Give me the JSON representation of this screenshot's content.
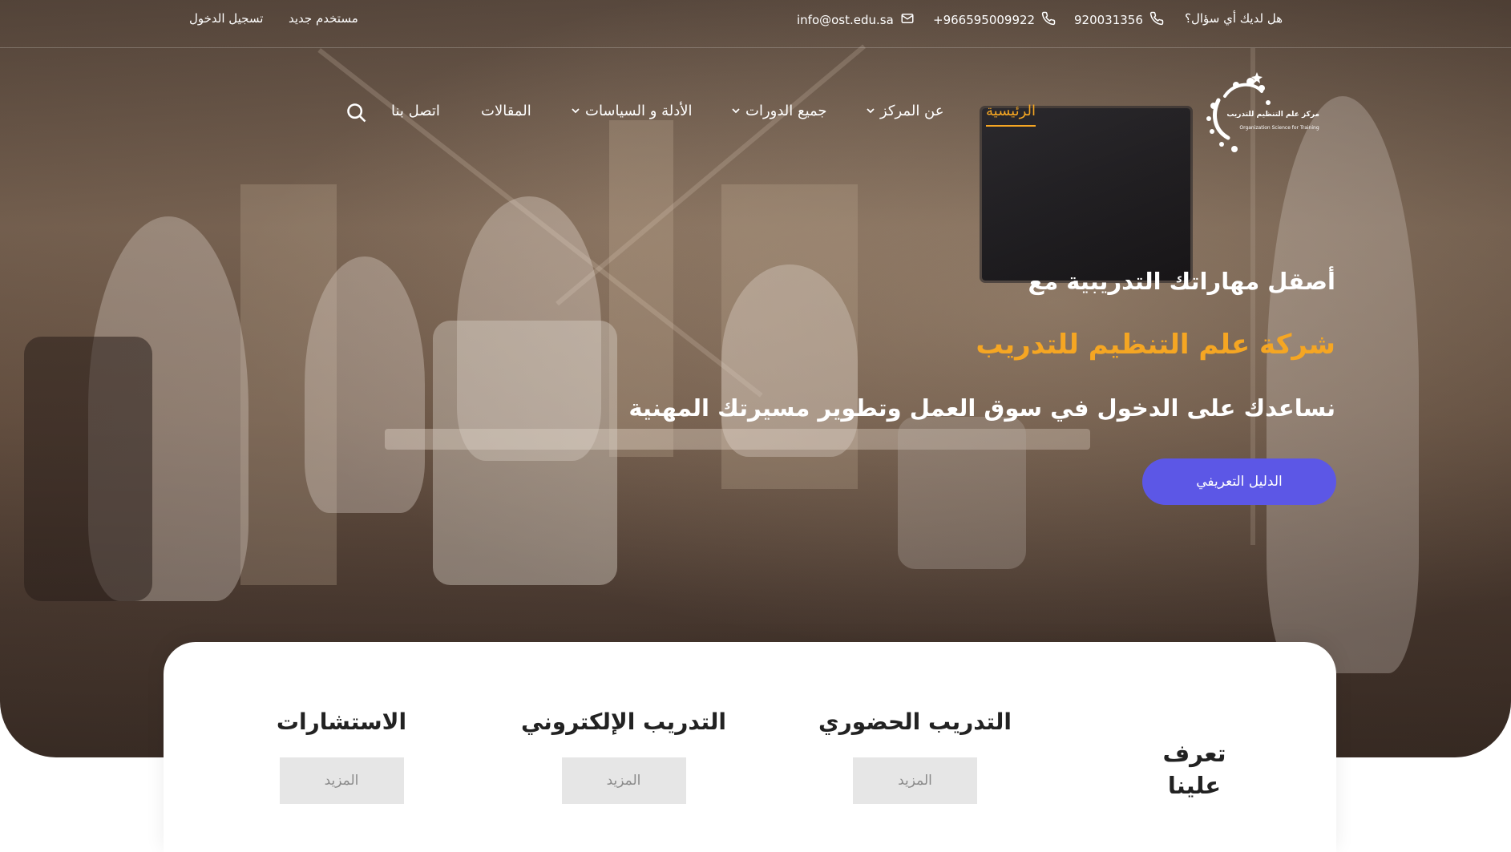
{
  "topbar": {
    "question": "هل لديك أي سؤال؟",
    "phone1": "920031356",
    "phone2": "+966595009922",
    "email": "info@ost.edu.sa",
    "register": "مستخدم جديد",
    "login": "تسجيل الدخول"
  },
  "logo": {
    "name_ar": "مركز علم التنظيم للتدريب",
    "name_en": "Organization Science for Training"
  },
  "nav": {
    "home": "الرئيسية",
    "about": "عن المركز",
    "courses": "جميع الدورات",
    "policies": "الأدلة و السياسات",
    "articles": "المقالات",
    "contact": "اتصل بنا"
  },
  "hero": {
    "line1": "أصقل مهاراتك التدريبية مع",
    "line2": "شركة علم التنظيم للتدريب",
    "line3": "نساعدك على الدخول في سوق العمل وتطوير مسيرتك المهنية",
    "button": "الدليل التعريفي"
  },
  "services": {
    "about_title": "تعرف علينا",
    "items": [
      {
        "title": "التدريب الحضوري",
        "more": "المزيد"
      },
      {
        "title": "التدريب الإلكتروني",
        "more": "المزيد"
      },
      {
        "title": "الاستشارات",
        "more": "المزيد"
      }
    ]
  },
  "colors": {
    "accent": "#f5a623",
    "button": "#5c57e6",
    "more_bg": "#e6e6e6"
  }
}
